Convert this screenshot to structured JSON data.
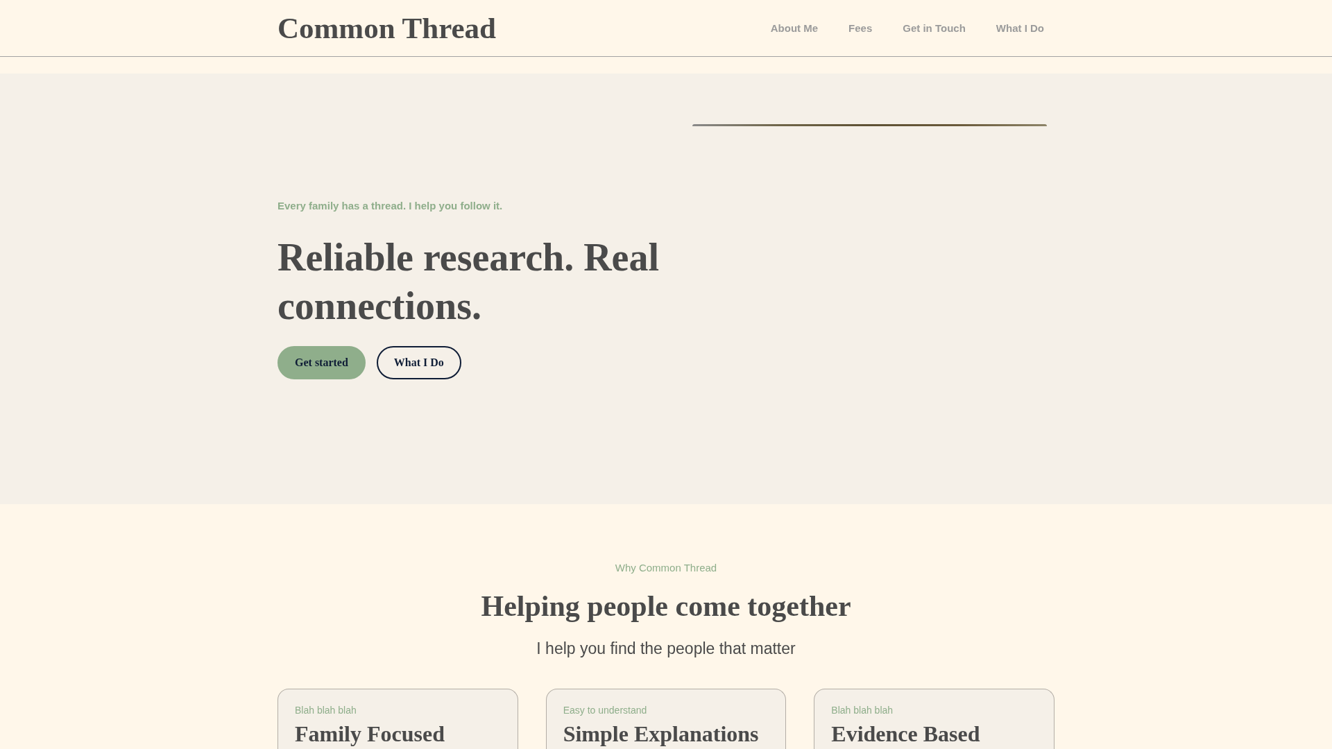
{
  "header": {
    "logo": "Common Thread",
    "nav": [
      {
        "label": "About Me"
      },
      {
        "label": "Fees"
      },
      {
        "label": "Get in Touch"
      },
      {
        "label": "What I Do"
      }
    ]
  },
  "hero": {
    "eyebrow": "Every family has a thread. I help you follow it.",
    "title": "Reliable research. Real connections.",
    "buttons": [
      {
        "label": "Get started",
        "kind": "primary"
      },
      {
        "label": "What I Do",
        "kind": "outline"
      }
    ]
  },
  "features": {
    "eyebrow": "Why Common Thread",
    "title": "Helping people come together",
    "subtitle": "I help you find the people that matter",
    "cards": [
      {
        "eyebrow": "Blah blah blah",
        "title": "Family Focused"
      },
      {
        "eyebrow": "Easy to understand",
        "title": "Simple Explanations"
      },
      {
        "eyebrow": "Blah blah blah",
        "title": "Evidence Based"
      }
    ]
  }
}
